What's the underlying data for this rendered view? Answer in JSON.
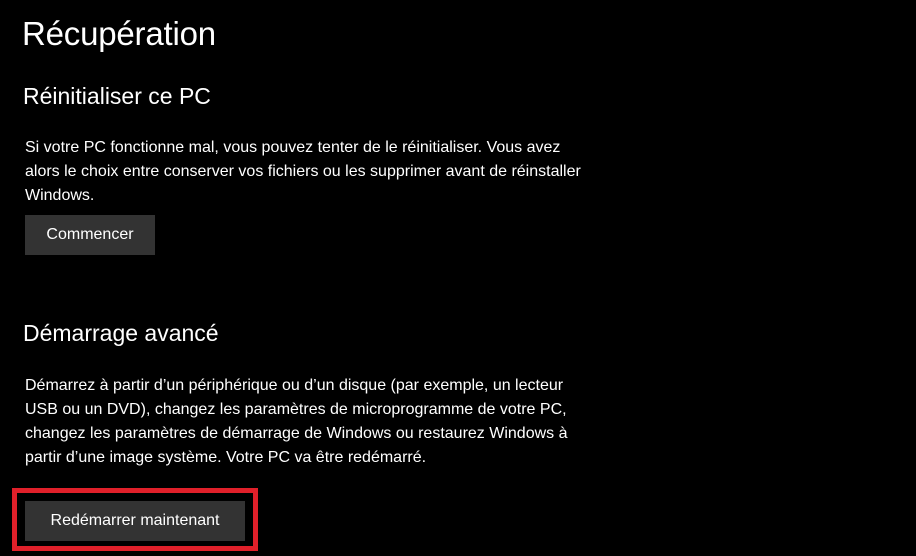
{
  "page": {
    "title": "Récupération"
  },
  "reset": {
    "title": "Réinitialiser ce PC",
    "description": "Si votre PC fonctionne mal, vous pouvez tenter de le réinitialiser. Vous avez alors le choix entre conserver vos fichiers ou les supprimer avant de réinstaller Windows.",
    "button_label": "Commencer"
  },
  "advanced": {
    "title": "Démarrage avancé",
    "description": "Démarrez à partir d’un périphérique ou d’un disque (par exemple, un lecteur USB ou un DVD), changez les paramètres de microprogramme de votre PC, changez les paramètres de démarrage de Windows ou restaurez Windows à partir d’une image système. Votre PC va être redémarré.",
    "button_label": "Redémarrer maintenant"
  },
  "colors": {
    "background": "#000000",
    "button": "#333333",
    "highlight": "#e0202a"
  }
}
